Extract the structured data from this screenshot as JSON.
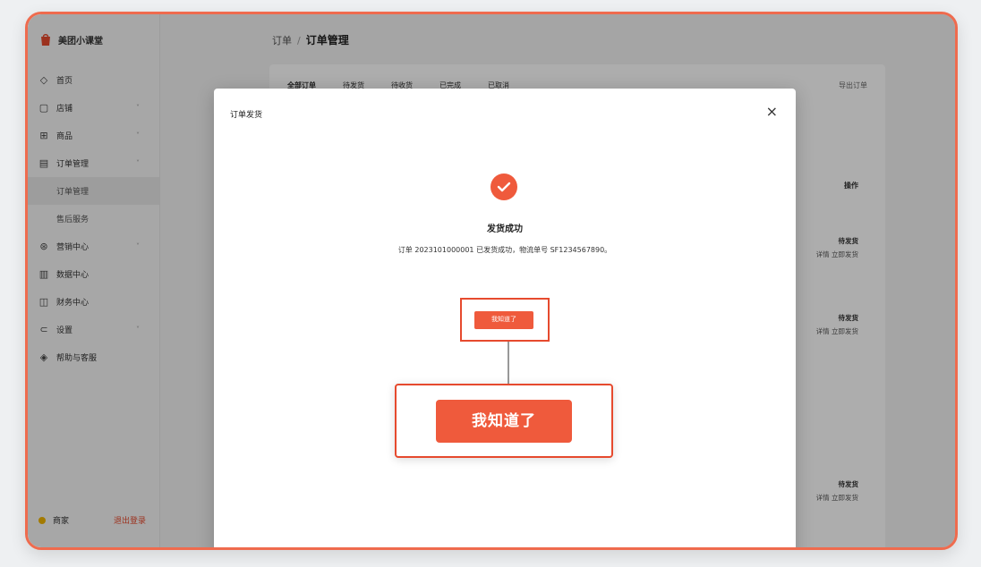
{
  "app": {
    "name": "美团小课堂"
  },
  "breadcrumb": {
    "parent": "订单",
    "current": "订单管理"
  },
  "sidebar": {
    "items": [
      {
        "label": "首页",
        "icon": "diamond-icon",
        "chevron": false
      },
      {
        "label": "店铺",
        "icon": "square-icon",
        "chevron": true
      },
      {
        "label": "商品",
        "icon": "grid-icon",
        "chevron": true
      },
      {
        "label": "订单管理",
        "icon": "document-icon",
        "chevron": true
      },
      {
        "label": "订单管理",
        "icon": "",
        "chevron": false,
        "sub": true,
        "active": true
      },
      {
        "label": "售后服务",
        "icon": "",
        "chevron": false,
        "sub": true
      },
      {
        "label": "营销中心",
        "icon": "gift-icon",
        "chevron": true
      },
      {
        "label": "数据中心",
        "icon": "chart-icon",
        "chevron": false
      },
      {
        "label": "财务中心",
        "icon": "wallet-icon",
        "chevron": false
      },
      {
        "label": "设置",
        "icon": "toggle-icon",
        "chevron": true
      },
      {
        "label": "帮助与客服",
        "icon": "help-icon",
        "chevron": false
      }
    ],
    "user": {
      "name": "商家",
      "logout": "退出登录"
    }
  },
  "panel": {
    "tabs": [
      "全部订单",
      "待发货",
      "待收货",
      "已完成",
      "已取消"
    ],
    "right_label": "导出订单",
    "column_head": "操作",
    "rows": [
      {
        "status": "待发货",
        "actions": "详情  立即发货"
      },
      {
        "status": "待发货",
        "actions": "详情  立即发货"
      },
      {
        "status": "待发货",
        "actions": "详情  立即发货"
      }
    ]
  },
  "modal": {
    "title": "订单发货",
    "close": "×",
    "result_title": "发货成功",
    "result_desc": "订单 2023101000001 已发货成功，物流单号 SF1234567890。",
    "small_button": "我知道了",
    "big_button": "我知道了"
  },
  "colors": {
    "accent": "#ef5a3c",
    "highlight": "#e64a2e"
  }
}
